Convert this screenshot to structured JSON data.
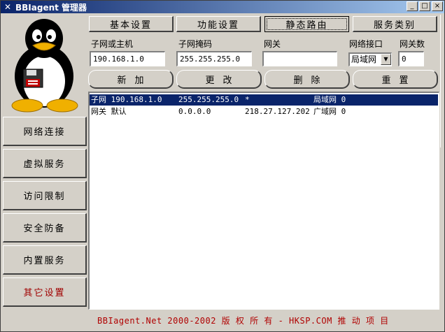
{
  "window": {
    "title": "BBIagent 管理器",
    "minimize": "_",
    "maximize": "□",
    "close": "×"
  },
  "tabs": [
    {
      "label": "基本设置"
    },
    {
      "label": "功能设置"
    },
    {
      "label": "静态路由"
    },
    {
      "label": "服务类别"
    }
  ],
  "form": {
    "subnet_label": "子网或主机",
    "subnet_value": "190.168.1.0",
    "mask_label": "子网掩码",
    "mask_value": "255.255.255.0",
    "gateway_label": "网关",
    "gateway_value": "",
    "iface_label": "网络接口",
    "iface_value": "局域网",
    "gwcount_label": "网关数",
    "gwcount_value": "0"
  },
  "actions": [
    {
      "label": "新加"
    },
    {
      "label": "更改"
    },
    {
      "label": "删除"
    },
    {
      "label": "重置"
    }
  ],
  "routes": [
    {
      "name": "子网 190.168.1.0",
      "mask": "255.255.255.0",
      "gateway": "*",
      "iface": "局域网 0"
    },
    {
      "name": "网关 默认",
      "mask": "0.0.0.0",
      "gateway": "218.27.127.202",
      "iface": "广域网 0"
    }
  ],
  "sidebar": [
    {
      "label": "网络连接"
    },
    {
      "label": "虚拟服务"
    },
    {
      "label": "访问限制"
    },
    {
      "label": "安全防备"
    },
    {
      "label": "内置服务"
    },
    {
      "label": "其它设置"
    }
  ],
  "footer": "BBIagent.Net 2000-2002 版 权 所 有 - HKSP.COM 推 动 项 目"
}
